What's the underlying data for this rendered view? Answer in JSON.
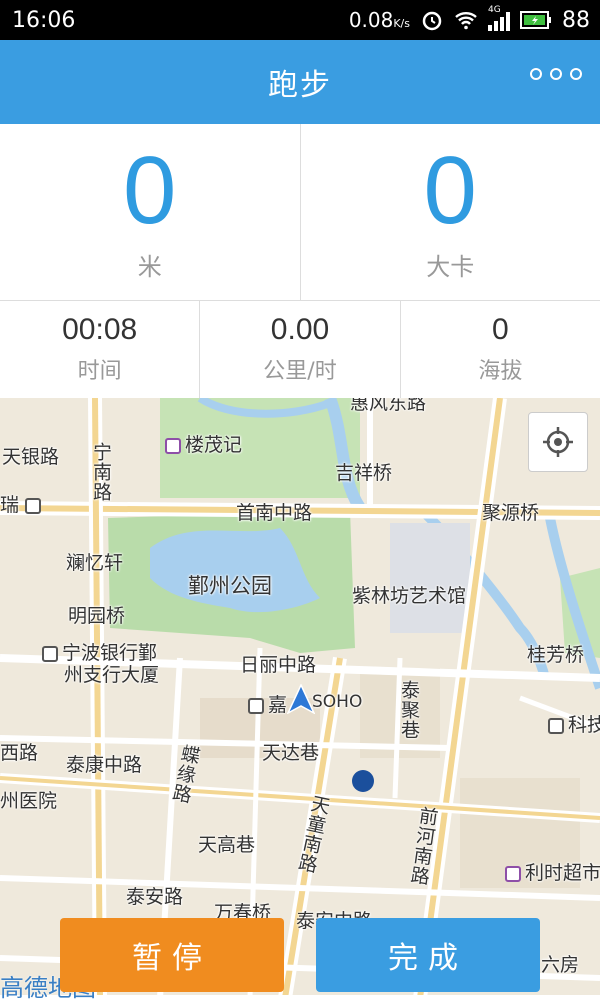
{
  "status_bar": {
    "time": "16:06",
    "net_speed": "0.08",
    "net_unit": "K/s",
    "network": "4G",
    "battery": "88"
  },
  "header": {
    "title": "跑步"
  },
  "stats": {
    "distance": {
      "value": "0",
      "unit": "米"
    },
    "calories": {
      "value": "0",
      "unit": "大卡"
    },
    "time": {
      "value": "00:08",
      "label": "时间"
    },
    "speed": {
      "value": "0.00",
      "label": "公里/时"
    },
    "altitude": {
      "value": "0",
      "label": "海拔"
    }
  },
  "map": {
    "labels": {
      "top_road": "惠风东路",
      "tianyin_road": "天银路",
      "loumaoji": "楼茂记",
      "ningnan_road": "宁南路",
      "jixiang_bridge": "吉祥桥",
      "rui": "瑞",
      "shounan_road": "首南中路",
      "juyuan_bridge": "聚源桥",
      "lanyi": "斓忆轩",
      "yinzhou_park": "鄞州公园",
      "zilinfang": "紫林坊艺术馆",
      "mingyuan_bridge": "明园桥",
      "guifang_bridge": "桂芳桥",
      "bank_line1": "宁波银行鄞",
      "bank_line2": "州支行大厦",
      "rili_road": "日丽中路",
      "jia": "嘉",
      "soho": "SOHO",
      "taiju_lane": "泰聚巷",
      "ke": "科技",
      "xi_road": "西路",
      "taikang_road": "泰康中路",
      "tianda_lane": "天达巷",
      "dieyuan_road": "蝶缘路",
      "hospital": "州医院",
      "tiantong_road": "天童南路",
      "qianhe_road": "前河南路",
      "tiangao_lane": "天高巷",
      "lishi": "利时超市",
      "taian_road": "泰安路",
      "wanchun_bridge": "万春桥",
      "tai": "泰安中路",
      "liufang": "六房"
    },
    "watermark": "高德地图"
  },
  "buttons": {
    "pause": "暂停",
    "done": "完成"
  },
  "colors": {
    "accent": "#3a9de1",
    "pause": "#f08c1f"
  }
}
